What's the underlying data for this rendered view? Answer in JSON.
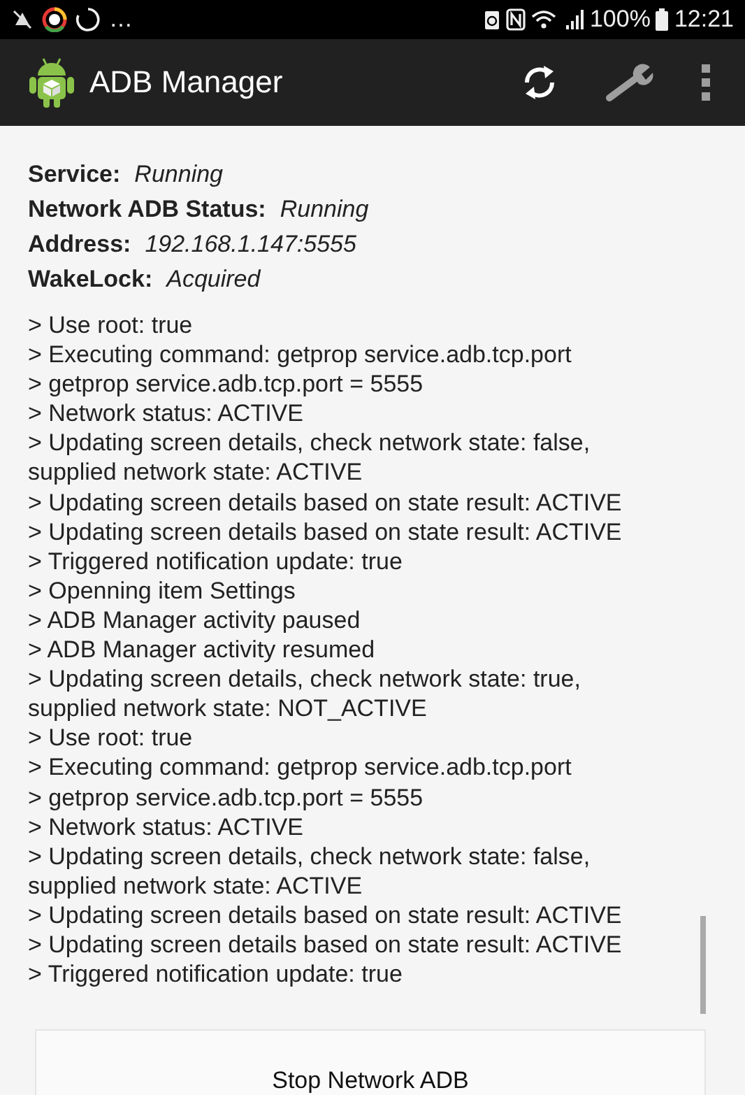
{
  "status_bar": {
    "overflow": "…",
    "battery": "100%",
    "time": "12:21"
  },
  "app_bar": {
    "title": "ADB Manager"
  },
  "status": [
    {
      "label": "Service:",
      "value": "Running"
    },
    {
      "label": "Network ADB Status:",
      "value": "Running"
    },
    {
      "label": "Address:",
      "value": "192.168.1.147:5555"
    },
    {
      "label": "WakeLock:",
      "value": "Acquired"
    }
  ],
  "log": [
    "> Use root: true",
    "> Executing command: getprop service.adb.tcp.port",
    "> getprop service.adb.tcp.port = 5555",
    "> Network status: ACTIVE",
    "> Updating screen details, check network state: false, supplied network state: ACTIVE",
    "> Updating screen details based on state result: ACTIVE",
    "> Updating screen details based on state result: ACTIVE",
    "> Triggered notification update: true",
    "> Openning item Settings",
    "> ADB Manager activity paused",
    "> ADB Manager activity resumed",
    "> Updating screen details, check network state: true, supplied network state: NOT_ACTIVE",
    "> Use root: true",
    "> Executing command: getprop service.adb.tcp.port",
    "> getprop service.adb.tcp.port = 5555",
    "> Network status: ACTIVE",
    "> Updating screen details, check network state: false, supplied network state: ACTIVE",
    "> Updating screen details based on state result: ACTIVE",
    "> Updating screen details based on state result: ACTIVE",
    "> Triggered notification update: true"
  ],
  "button": "Stop Network ADB"
}
